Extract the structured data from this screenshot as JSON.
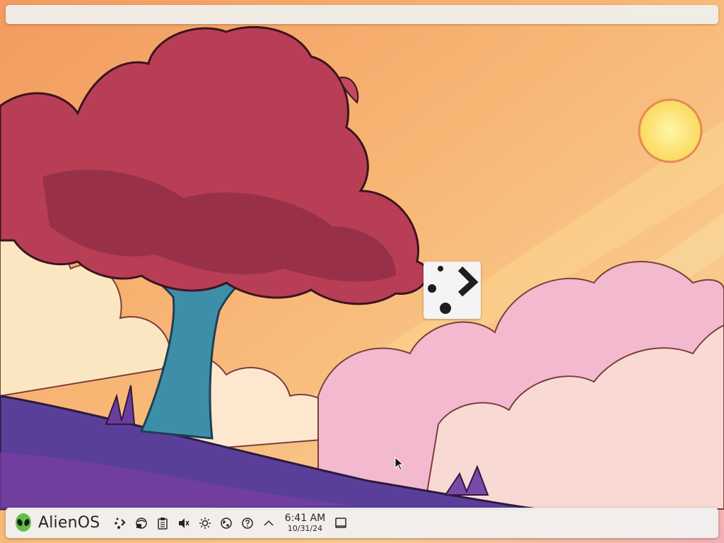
{
  "launcher": {
    "label": "AlienOS",
    "icon": "alien-head-icon"
  },
  "tray": [
    {
      "name": "kde-connect-icon"
    },
    {
      "name": "network-icon"
    },
    {
      "name": "clipboard-icon"
    },
    {
      "name": "volume-muted-icon"
    },
    {
      "name": "brightness-icon"
    },
    {
      "name": "globe-icon"
    },
    {
      "name": "help-icon"
    },
    {
      "name": "expand-tray-icon"
    }
  ],
  "clock": {
    "time": "6:41 AM",
    "date": "10/31/24"
  },
  "colors": {
    "accent": "#232629",
    "panel": "#f2f0ee"
  }
}
